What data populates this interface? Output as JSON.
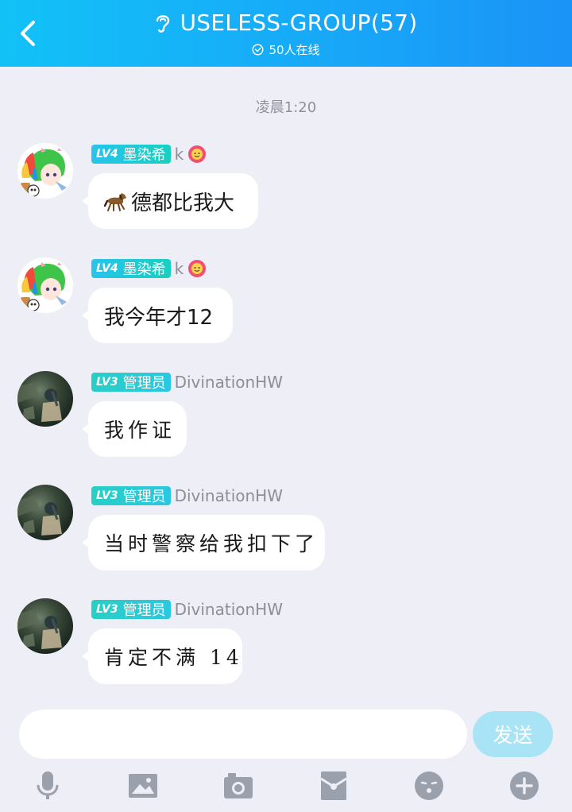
{
  "header": {
    "title": "USELESS-GROUP(57)",
    "online": "50人在线",
    "icons": {
      "back": "chevron-left-icon",
      "group": "ear-icon",
      "online": "check-circle-icon"
    }
  },
  "timestamp": "凌晨1:20",
  "messages": [
    {
      "level": "LV4",
      "role": "墨染希",
      "sender": "k",
      "text": "德都比我大",
      "emoji": "horse-emoji",
      "avatar": "anime-avatar"
    },
    {
      "level": "LV4",
      "role": "墨染希",
      "sender": "k",
      "text": "我今年才12",
      "avatar": "anime-avatar"
    },
    {
      "level": "LV3",
      "role": "管理员",
      "sender": "DivinationHW",
      "text": "我作证",
      "avatar": "photo-avatar"
    },
    {
      "level": "LV3",
      "role": "管理员",
      "sender": "DivinationHW",
      "text": "当时警察给我扣下了",
      "avatar": "photo-avatar"
    },
    {
      "level": "LV3",
      "role": "管理员",
      "sender": "DivinationHW",
      "text": "肯定不满 14",
      "avatar": "photo-avatar"
    }
  ],
  "input": {
    "placeholder": "",
    "send_label": "发送"
  },
  "toolbar": [
    "microphone-icon",
    "image-icon",
    "camera-icon",
    "red-packet-icon",
    "emoji-icon",
    "plus-icon"
  ],
  "colors": {
    "header_start": "#12c2f7",
    "header_end": "#1b93f7",
    "background": "#eeeef6",
    "send_button": "#a8e4f6",
    "lv4_badge": "#29c3ec",
    "lv3_badge": "#28cfc4"
  }
}
